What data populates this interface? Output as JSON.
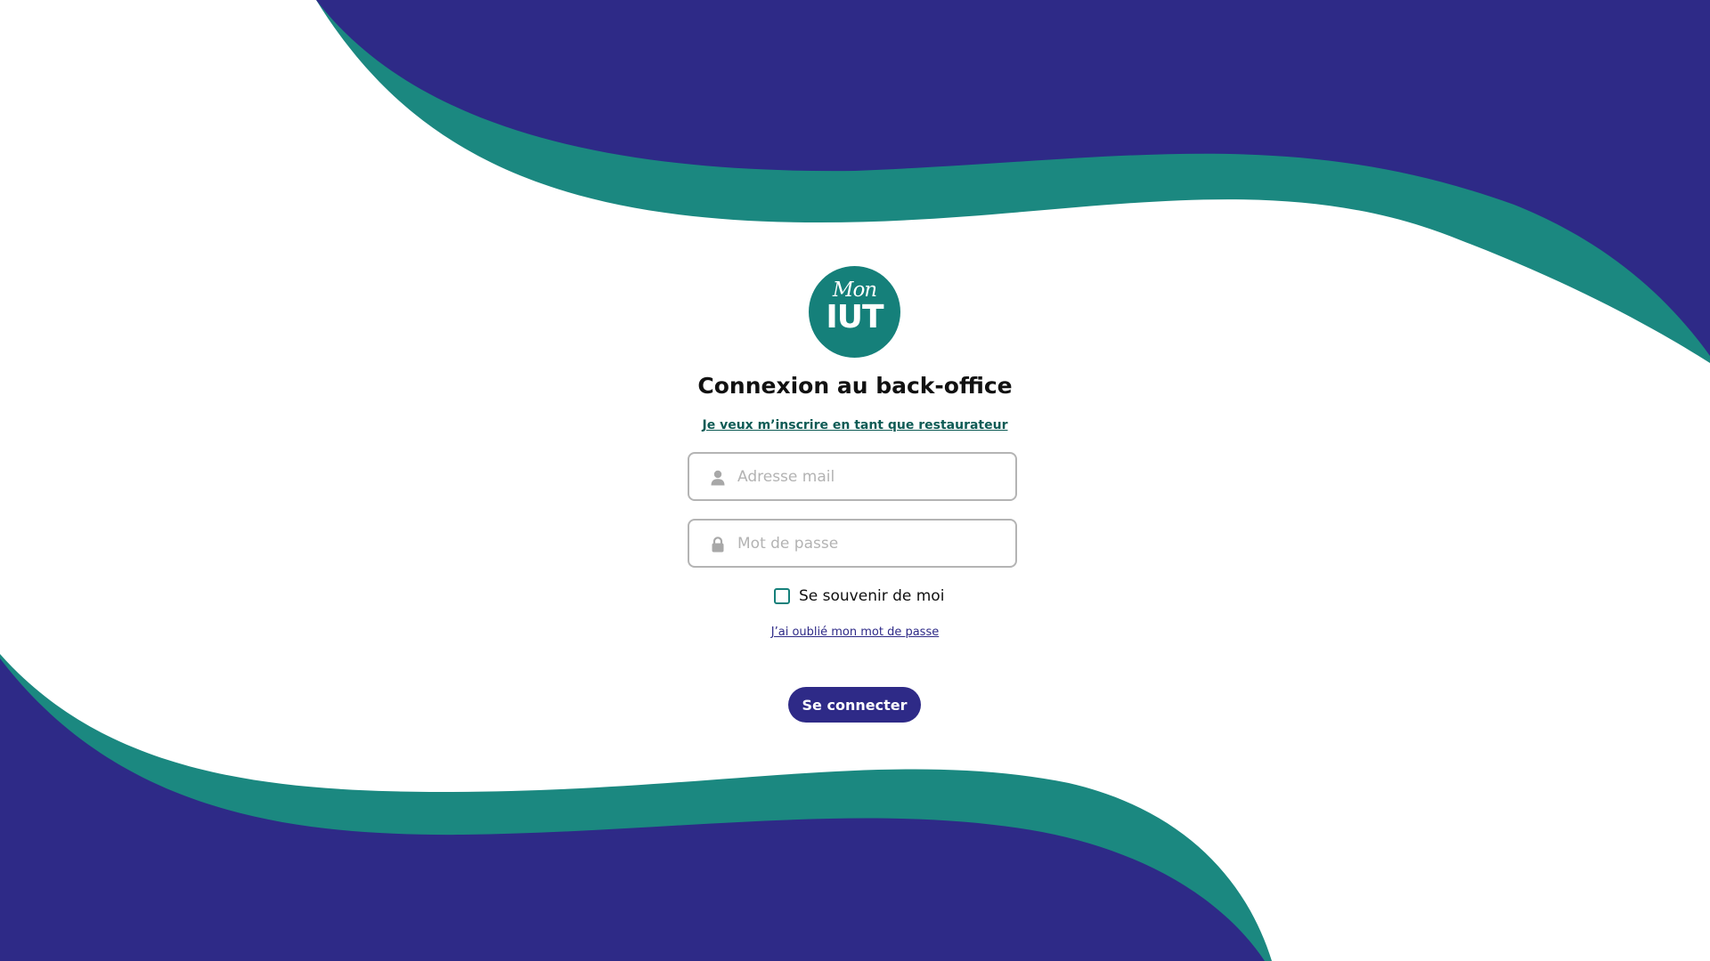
{
  "theme": {
    "brand_teal": "#15807a",
    "brand_navy": "#2e2a87",
    "background": "#ffffff"
  },
  "logo": {
    "text_top": "Mon",
    "text_main": "IUT"
  },
  "login": {
    "title": "Connexion au back-office",
    "register_link": "Je veux m’inscrire en tant que restaurateur",
    "email": {
      "placeholder": "Adresse mail",
      "value": "",
      "icon": "user-icon"
    },
    "password": {
      "placeholder": "Mot de passe",
      "value": "",
      "icon": "lock-icon"
    },
    "remember": {
      "label": "Se souvenir de moi",
      "checked": false
    },
    "forgot_link": "J’ai oublié mon mot de passe",
    "submit_label": "Se connecter"
  }
}
